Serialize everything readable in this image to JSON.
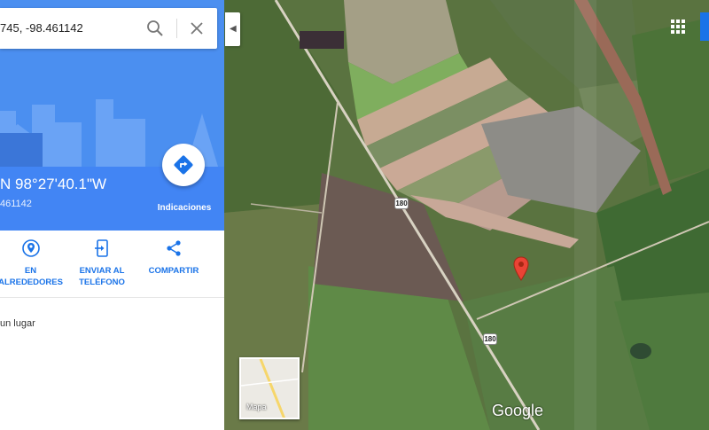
{
  "search": {
    "query": "745, -98.461142"
  },
  "place": {
    "title": "N 98°27'40.1\"W",
    "subtitle": "461142"
  },
  "directions": {
    "label": "Indicaciones"
  },
  "actions": [
    {
      "icon": "location-pin-icon",
      "label_line1": "EN",
      "label_line2": "ALREDEDORES"
    },
    {
      "icon": "send-to-phone-icon",
      "label_line1": "ENVIAR AL",
      "label_line2": "TELÉFONO"
    },
    {
      "icon": "share-icon",
      "label_line1": "COMPARTIR",
      "label_line2": ""
    }
  ],
  "add_place": "un lugar",
  "map": {
    "road_shield_1": "180",
    "road_shield_2": "180",
    "minimap_label": "Mapa",
    "logo": "Google"
  },
  "colors": {
    "panel_blue": "#4285f4",
    "action_blue": "#1a73e8",
    "pin_red": "#ea4335"
  }
}
